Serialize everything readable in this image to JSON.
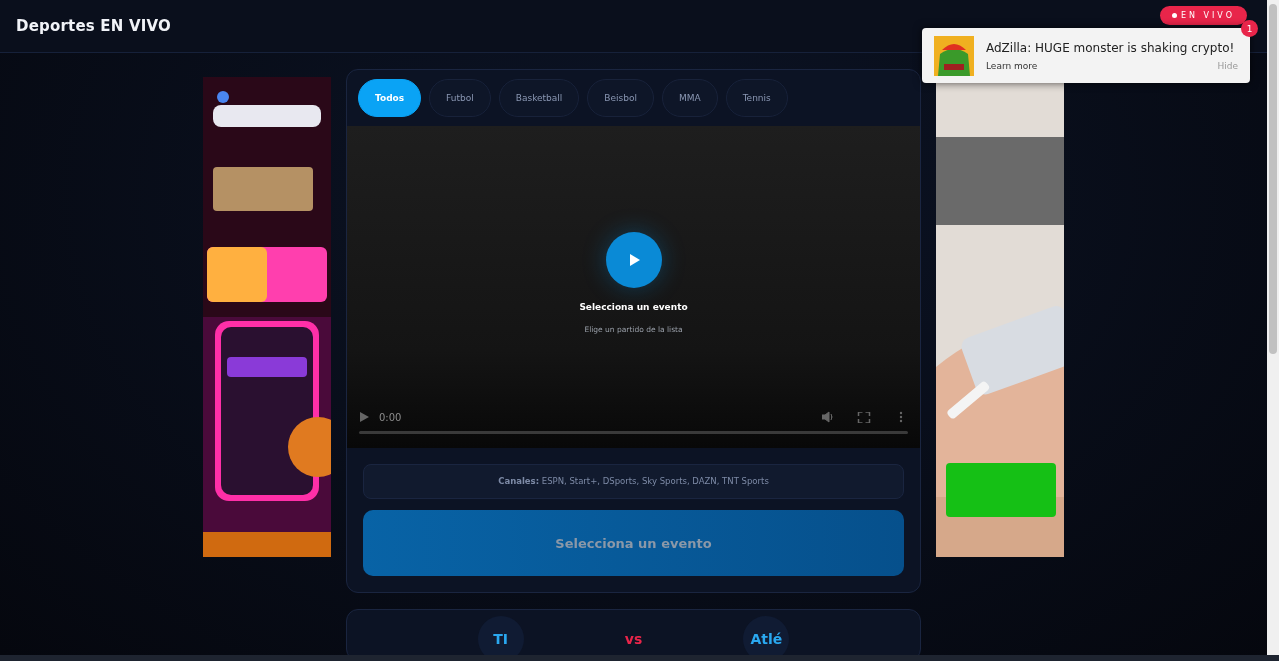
{
  "header": {
    "title": "Deportes EN VIVO",
    "live_badge": "EN VIVO"
  },
  "notification": {
    "title": "AdZilla: HUGE monster is shaking crypto!",
    "link": "Learn more",
    "dismiss": "Hide",
    "count": "1"
  },
  "tabs": [
    {
      "label": "Todos",
      "selected": true
    },
    {
      "label": "Futbol",
      "selected": false
    },
    {
      "label": "Basketball",
      "selected": false
    },
    {
      "label": "Beisbol",
      "selected": false
    },
    {
      "label": "MMA",
      "selected": false
    },
    {
      "label": "Tennis",
      "selected": false
    }
  ],
  "player": {
    "title": "Selecciona un evento",
    "subtitle": "Elige un partido de la lista",
    "time": "0:00"
  },
  "channels": "**Canales:** ESPN, Start+, DSports, Sky Sports, DAZN, TNT Sports",
  "watch_button": {
    "label": "Selecciona un evento",
    "disabled": true
  },
  "match": {
    "home": "TI",
    "separator": "vs",
    "away": "Atlé"
  }
}
